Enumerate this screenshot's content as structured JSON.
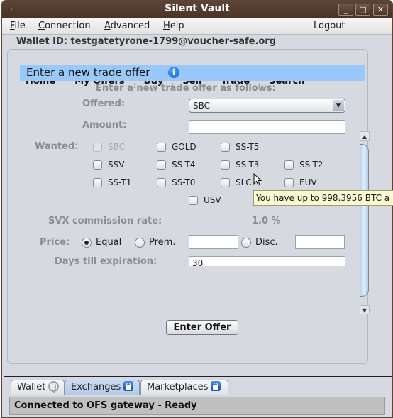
{
  "window": {
    "title": "Silent Vault",
    "controls": {
      "minimize": "_",
      "maximize": "□",
      "close": "✕"
    }
  },
  "menubar": {
    "items": [
      {
        "label": "File",
        "mnemonic": "F"
      },
      {
        "label": "Connection",
        "mnemonic": "C"
      },
      {
        "label": "Advanced",
        "mnemonic": "A"
      },
      {
        "label": "Help",
        "mnemonic": "H"
      }
    ],
    "logout": "Logout"
  },
  "wallet_id": "Wallet ID: testgatetyrone-1799@voucher-safe.org",
  "nav": {
    "items": [
      "Home",
      "My Offers",
      "Buy",
      "Sell",
      "Trade",
      "Search"
    ]
  },
  "section": {
    "title": "Enter a new trade offer",
    "info_icon": "i"
  },
  "form": {
    "intro": "Enter a new trade offer as follows:",
    "offered_label": "Offered:",
    "offered_value": "SBC",
    "amount_label": "Amount:",
    "amount_value": "",
    "wanted_label": "Wanted:",
    "wanted_options": [
      {
        "label": "SBC",
        "checked": false,
        "disabled": true
      },
      {
        "label": "GOLD",
        "checked": false,
        "disabled": false
      },
      {
        "label": "SS-T5",
        "checked": false,
        "disabled": false
      },
      {
        "label": "SSV",
        "checked": false,
        "disabled": false
      },
      {
        "label": "SS-T4",
        "checked": false,
        "disabled": false
      },
      {
        "label": "SS-T3",
        "checked": false,
        "disabled": false
      },
      {
        "label": "SS-T2",
        "checked": false,
        "disabled": false
      },
      {
        "label": "SS-T1",
        "checked": false,
        "disabled": false
      },
      {
        "label": "SS-T0",
        "checked": false,
        "disabled": false
      },
      {
        "label": "SLC",
        "checked": false,
        "disabled": false
      },
      {
        "label": "EUV",
        "checked": false,
        "disabled": false
      },
      {
        "label": "USV",
        "checked": false,
        "disabled": false
      }
    ],
    "commission_label": "SVX commission rate:",
    "commission_value": "1.0 %",
    "price_label": "Price:",
    "price_options": {
      "equal": "Equal",
      "premium": "Prem.",
      "discount": "Disc.",
      "selected": "Equal"
    },
    "premium_value": "",
    "discount_value": "",
    "expiration_label": "Days till expiration:",
    "expiration_value": "30",
    "submit_label": "Enter Offer"
  },
  "tooltip": "You have up to 998.3956 BTC a",
  "tabs": [
    {
      "label": "Wallet",
      "icon": "globe-icon",
      "active": false
    },
    {
      "label": "Exchanges",
      "icon": "lock-icon",
      "active": true
    },
    {
      "label": "Marketplaces",
      "icon": "lock-icon",
      "active": false
    }
  ],
  "status": "Connected to OFS gateway - Ready"
}
